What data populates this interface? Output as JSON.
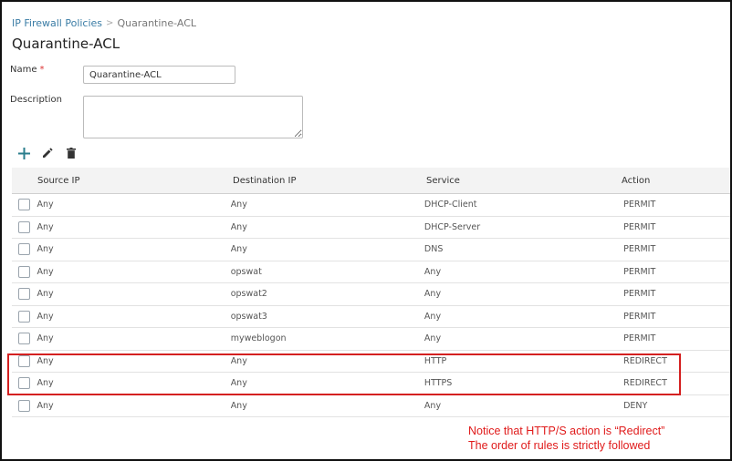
{
  "breadcrumb": {
    "parent": "IP Firewall Policies",
    "separator": ">",
    "current": "Quarantine-ACL"
  },
  "page_title": "Quarantine-ACL",
  "form": {
    "name_label": "Name",
    "name_required": "*",
    "name_value": "Quarantine-ACL",
    "description_label": "Description",
    "description_value": ""
  },
  "toolbar": {
    "add_icon": "plus-icon",
    "edit_icon": "pencil-icon",
    "delete_icon": "trash-icon"
  },
  "table": {
    "headers": {
      "source": "Source IP",
      "destination": "Destination IP",
      "service": "Service",
      "action": "Action"
    },
    "rows": [
      {
        "source": "Any",
        "destination": "Any",
        "service": "DHCP-Client",
        "action": "PERMIT"
      },
      {
        "source": "Any",
        "destination": "Any",
        "service": "DHCP-Server",
        "action": "PERMIT"
      },
      {
        "source": "Any",
        "destination": "Any",
        "service": "DNS",
        "action": "PERMIT"
      },
      {
        "source": "Any",
        "destination": "opswat",
        "service": "Any",
        "action": "PERMIT"
      },
      {
        "source": "Any",
        "destination": "opswat2",
        "service": "Any",
        "action": "PERMIT"
      },
      {
        "source": "Any",
        "destination": "opswat3",
        "service": "Any",
        "action": "PERMIT"
      },
      {
        "source": "Any",
        "destination": "myweblogon",
        "service": "Any",
        "action": "PERMIT"
      },
      {
        "source": "Any",
        "destination": "Any",
        "service": "HTTP",
        "action": "REDIRECT"
      },
      {
        "source": "Any",
        "destination": "Any",
        "service": "HTTPS",
        "action": "REDIRECT"
      },
      {
        "source": "Any",
        "destination": "Any",
        "service": "Any",
        "action": "DENY"
      }
    ]
  },
  "annotation": {
    "line1": "Notice that HTTP/S action is “Redirect”",
    "line2": "The order of rules is strictly followed"
  },
  "colors": {
    "link": "#3a7ca5",
    "accent_teal": "#2a7d8c",
    "annotation_red": "#e01b1b"
  }
}
